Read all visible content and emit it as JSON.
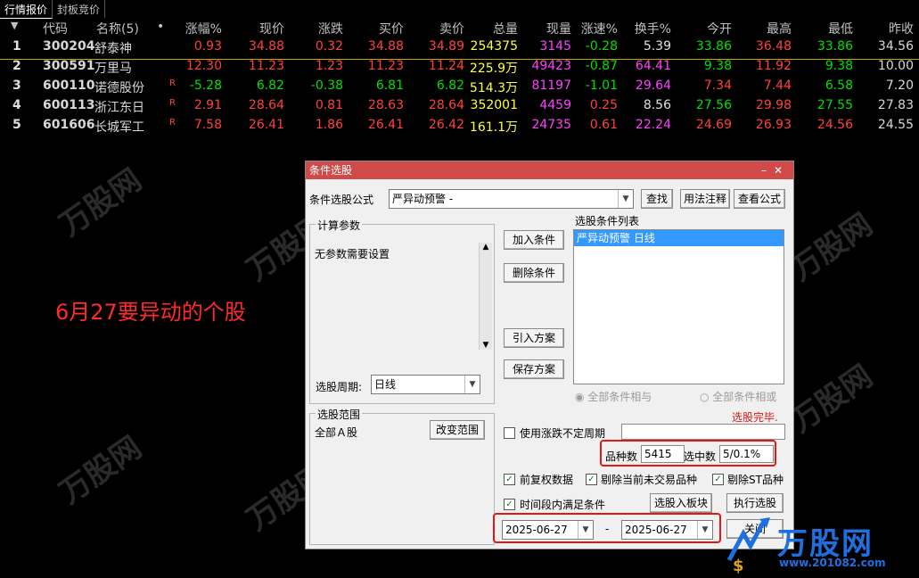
{
  "tabs": [
    "行情报价",
    "封板竞价"
  ],
  "columns": [
    "代码",
    "名称(5)",
    "•",
    "涨幅%",
    "现价",
    "涨跌",
    "买价",
    "卖价",
    "总量",
    "现量",
    "涨速%",
    "换手%",
    "今开",
    "最高",
    "最低",
    "昨收"
  ],
  "rows": [
    {
      "idx": "1",
      "code": "300204",
      "name": "舒泰神",
      "flag": "",
      "pct": "0.93",
      "price": "34.88",
      "chg": "0.32",
      "bid": "34.88",
      "ask": "34.89",
      "vol": "254375",
      "cur": "3145",
      "spd": "-0.28",
      "turn": "5.39",
      "open": "33.86",
      "high": "36.48",
      "low": "33.86",
      "prev": "34.56"
    },
    {
      "idx": "2",
      "code": "300591",
      "name": "万里马",
      "flag": "",
      "pct": "12.30",
      "price": "11.23",
      "chg": "1.23",
      "bid": "11.23",
      "ask": "11.24",
      "vol": "225.9万",
      "cur": "49423",
      "spd": "-0.87",
      "turn": "64.41",
      "open": "9.38",
      "high": "11.92",
      "low": "9.38",
      "prev": "10.00"
    },
    {
      "idx": "3",
      "code": "600110",
      "name": "诺德股份",
      "flag": "R",
      "pct": "-5.28",
      "price": "6.82",
      "chg": "-0.38",
      "bid": "6.81",
      "ask": "6.82",
      "vol": "514.3万",
      "cur": "81197",
      "spd": "-1.01",
      "turn": "29.64",
      "open": "7.34",
      "high": "7.44",
      "low": "6.58",
      "prev": "7.20"
    },
    {
      "idx": "4",
      "code": "600113",
      "name": "浙江东日",
      "flag": "R",
      "pct": "2.91",
      "price": "28.64",
      "chg": "0.81",
      "bid": "28.63",
      "ask": "28.64",
      "vol": "352001",
      "cur": "4459",
      "spd": "0.25",
      "turn": "8.56",
      "open": "27.56",
      "high": "29.98",
      "low": "27.55",
      "prev": "27.83"
    },
    {
      "idx": "5",
      "code": "601606",
      "name": "长城军工",
      "flag": "R",
      "pct": "7.58",
      "price": "26.41",
      "chg": "1.86",
      "bid": "26.41",
      "ask": "26.42",
      "vol": "161.1万",
      "cur": "24735",
      "spd": "0.61",
      "turn": "22.24",
      "open": "24.69",
      "high": "26.93",
      "low": "24.56",
      "prev": "24.55"
    }
  ],
  "annotation": "6月27要异动的个股",
  "dialog": {
    "title": "条件选股",
    "formula_label": "条件选股公式",
    "formula_value": "严异动预警  -",
    "btn_find": "查找",
    "btn_usage": "用法注释",
    "btn_view": "查看公式",
    "calc_params_label": "计算参数",
    "no_params": "无参数需要设置",
    "period_label": "选股周期:",
    "period_value": "日线",
    "cond_list_label": "选股条件列表",
    "cond_item": "严异动预警  日线",
    "btn_add": "加入条件",
    "btn_delete": "删除条件",
    "btn_import": "引入方案",
    "btn_save": "保存方案",
    "radio_and": "全部条件相与",
    "radio_or": "全部条件相或",
    "status": "选股完毕.",
    "range_label": "选股范围",
    "range_value": "全部Ａ股",
    "btn_change_range": "改变范围",
    "chk_uncertain": "使用涨跌不定周期",
    "count_label": "品种数",
    "count_value": "5415",
    "selected_label": "选中数",
    "selected_value": "5/0.1%",
    "chk_restore": "前复权数据",
    "chk_exclude_untraded": "剔除当前未交易品种",
    "chk_exclude_st": "剔除ST品种",
    "chk_time_range": "时间段内满足条件",
    "btn_to_block": "选股入板块",
    "btn_execute": "执行选股",
    "date_from": "2025-06-27",
    "date_sep": "-",
    "date_to": "2025-06-27",
    "btn_close": "关闭"
  },
  "logo": {
    "text": "万股网",
    "url": "www.201082.com"
  },
  "colors": {
    "title_bar": "#d04a4a",
    "highlight": "#e01818",
    "rise": "#ff4040",
    "fall": "#00e000"
  }
}
